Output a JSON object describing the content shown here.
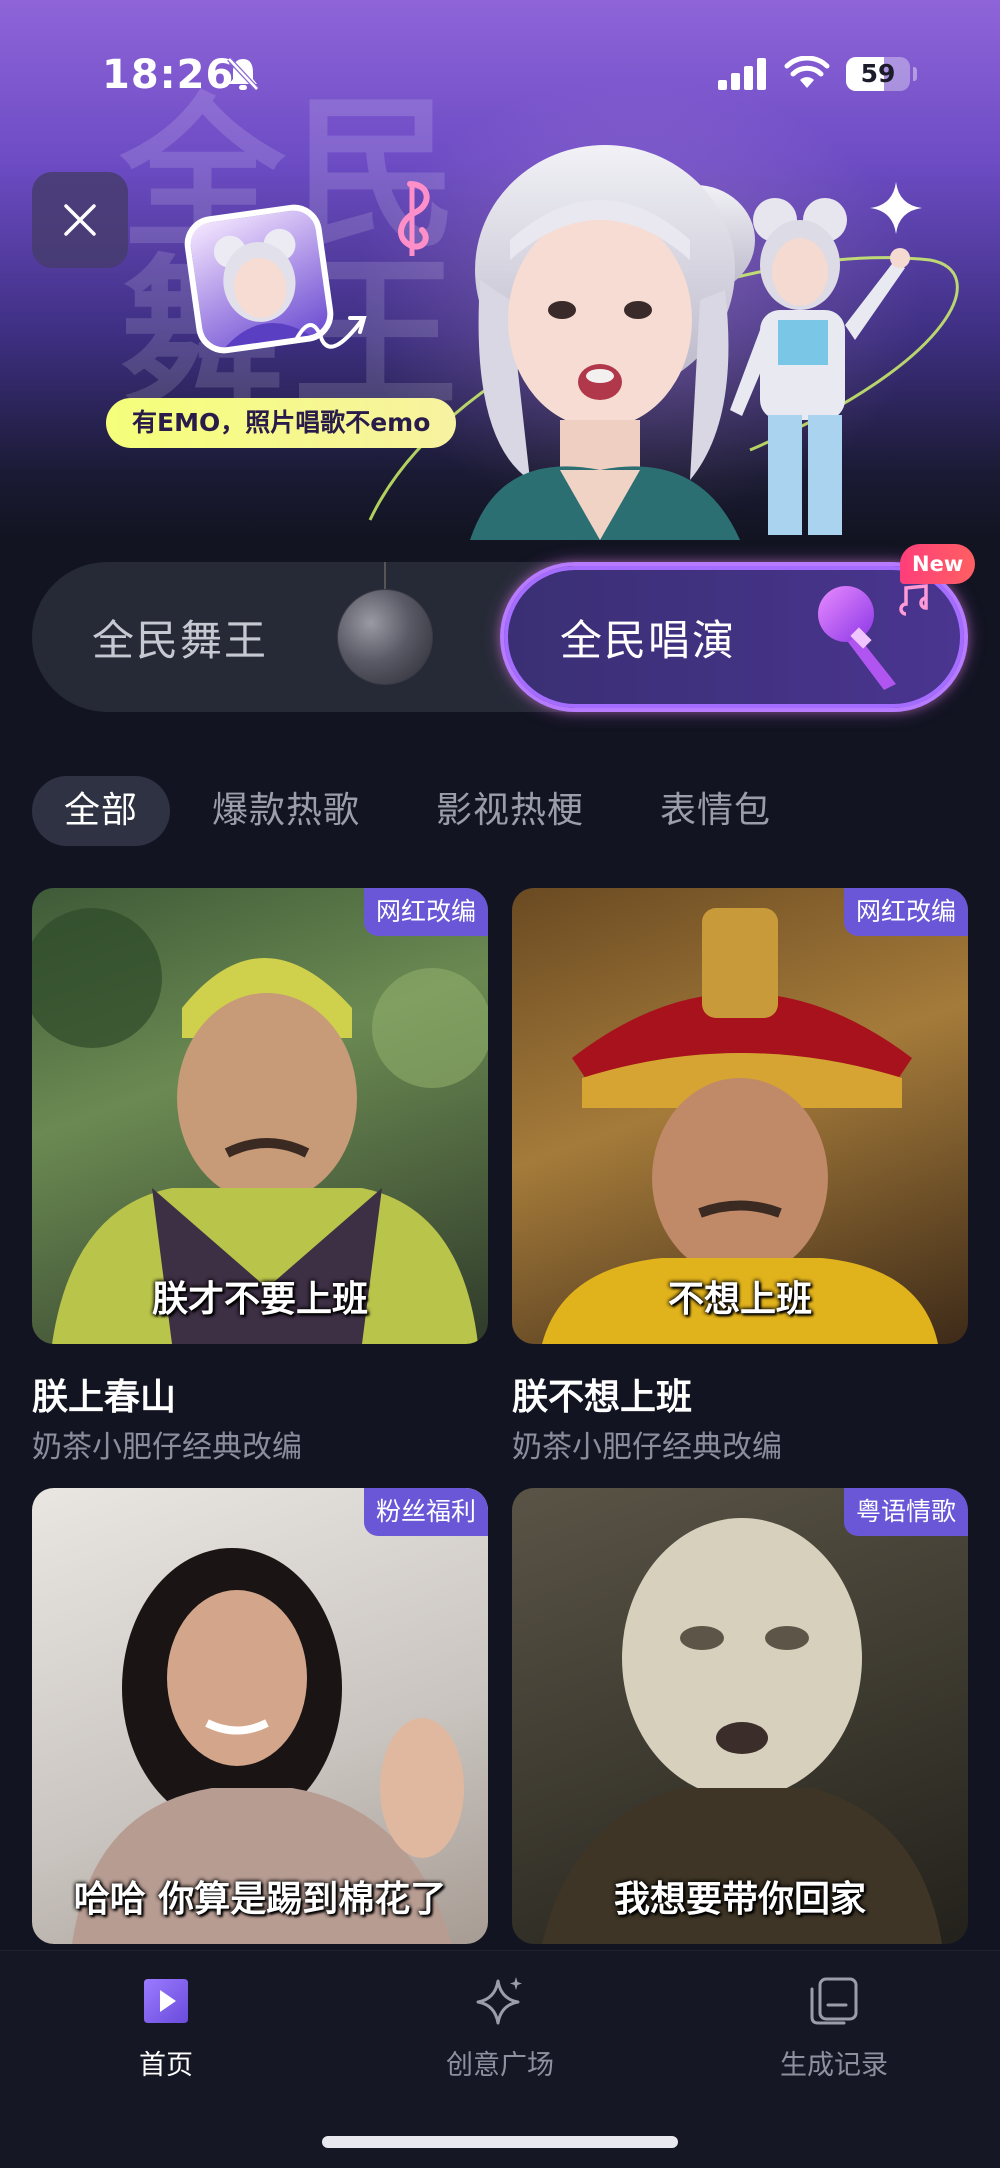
{
  "status_bar": {
    "time": "18:26",
    "battery": "59",
    "battery_level_percent": 59
  },
  "hero": {
    "watermark_text": "全民舞王",
    "badge": "有EMO，照片唱歌不emo"
  },
  "mode_switch": {
    "left_label": "全民舞王",
    "right_label": "全民唱演",
    "new_badge": "New"
  },
  "tabs": [
    {
      "label": "全部",
      "active": true
    },
    {
      "label": "爆款热歌",
      "active": false
    },
    {
      "label": "影视热梗",
      "active": false
    },
    {
      "label": "表情包",
      "active": false
    }
  ],
  "cards": [
    {
      "tag": "网红改编",
      "caption": "朕才不要上班",
      "title": "朕上春山",
      "subtitle": "奶茶小肥仔经典改编"
    },
    {
      "tag": "网红改编",
      "caption": "不想上班",
      "title": "朕不想上班",
      "subtitle": "奶茶小肥仔经典改编"
    },
    {
      "tag": "粉丝福利",
      "caption": "哈哈  你算是踢到棉花了"
    },
    {
      "tag": "粤语情歌",
      "caption": "我想要带你回家"
    }
  ],
  "bottom_nav": [
    {
      "label": "首页",
      "icon": "home-play-icon",
      "active": true
    },
    {
      "label": "创意广场",
      "icon": "sparkle-icon",
      "active": false
    },
    {
      "label": "生成记录",
      "icon": "record-icon",
      "active": false
    }
  ],
  "colors": {
    "background": "#121421",
    "accent": "#6a57d8",
    "active_border": "#b77bff",
    "new_badge": "#ff3e7a",
    "emo_badge": "#f5ff7a"
  }
}
